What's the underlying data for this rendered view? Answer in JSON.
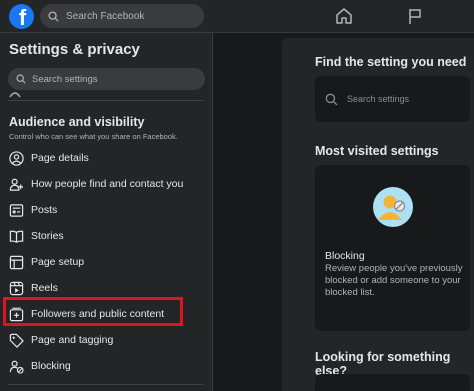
{
  "topbar": {
    "logo_letter": "f",
    "search_placeholder": "Search Facebook"
  },
  "sidebar": {
    "title": "Settings & privacy",
    "search_placeholder": "Search settings",
    "section_title": "Audience and visibility",
    "section_subtitle": "Control who can see what you share on Facebook.",
    "items": [
      {
        "label": "Page details",
        "icon": "person-circle-icon"
      },
      {
        "label": "How people find and contact you",
        "icon": "person-add-icon"
      },
      {
        "label": "Posts",
        "icon": "posts-icon"
      },
      {
        "label": "Stories",
        "icon": "book-icon"
      },
      {
        "label": "Page setup",
        "icon": "page-setup-icon"
      },
      {
        "label": "Reels",
        "icon": "reels-icon"
      },
      {
        "label": "Followers and public content",
        "icon": "followers-icon",
        "highlighted": true
      },
      {
        "label": "Page and tagging",
        "icon": "tag-icon"
      },
      {
        "label": "Blocking",
        "icon": "block-icon"
      }
    ]
  },
  "main": {
    "find_title": "Find the setting you need",
    "find_placeholder": "Search settings",
    "most_visited_title": "Most visited settings",
    "card": {
      "title": "Blocking",
      "description": "Review people you've previously blocked or add someone to your blocked list."
    },
    "looking_title": "Looking for something else?"
  },
  "colors": {
    "background": "#18191a",
    "surface": "#242526",
    "highlight_border": "#e0141e",
    "brand": "#1877f2"
  }
}
